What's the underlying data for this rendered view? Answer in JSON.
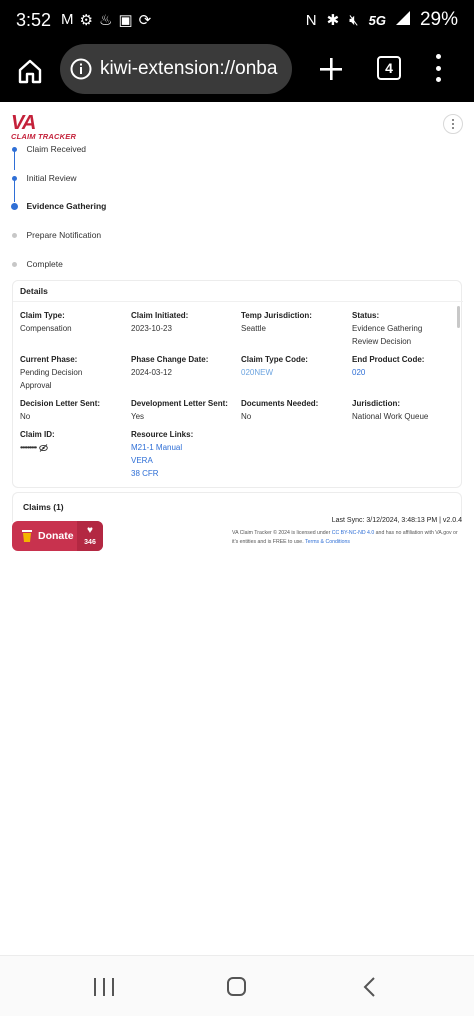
{
  "status_bar": {
    "time": "3:52",
    "left_icons": [
      "gmail-icon",
      "settings-icon",
      "fire-icon",
      "gallery-icon",
      "sync-icon"
    ],
    "network": "5G",
    "battery": "29%"
  },
  "browser": {
    "url": "kiwi-extension://onba",
    "tab_count": "4"
  },
  "app": {
    "logo_main": "VA",
    "logo_sub": "CLAIM TRACKER"
  },
  "timeline": {
    "steps": [
      {
        "label": "Claim Received",
        "state": "done"
      },
      {
        "label": "Initial Review",
        "state": "done"
      },
      {
        "label": "Evidence Gathering",
        "state": "current"
      },
      {
        "label": "Prepare Notification",
        "state": "pending"
      },
      {
        "label": "Complete",
        "state": "pending"
      }
    ]
  },
  "details": {
    "title": "Details",
    "claim_type_label": "Claim Type:",
    "claim_type_value": "Compensation",
    "claim_initiated_label": "Claim Initiated:",
    "claim_initiated_value": "2023-10-23",
    "temp_jurisdiction_label": "Temp Jurisdiction:",
    "temp_jurisdiction_value": "Seattle",
    "status_label": "Status:",
    "status_value": "Evidence Gathering Review Decision",
    "current_phase_label": "Current Phase:",
    "current_phase_value": "Pending Decision Approval",
    "phase_change_label": "Phase Change Date:",
    "phase_change_value": "2024-03-12",
    "claim_type_code_label": "Claim Type Code:",
    "claim_type_code_value": "020NEW",
    "end_product_code_label": "End Product Code:",
    "end_product_code_value": "020",
    "decision_letter_label": "Decision Letter Sent:",
    "decision_letter_value": "No",
    "development_letter_label": "Development Letter Sent:",
    "development_letter_value": "Yes",
    "documents_needed_label": "Documents Needed:",
    "documents_needed_value": "No",
    "jurisdiction_label": "Jurisdiction:",
    "jurisdiction_value": "National Work Queue",
    "claim_id_label": "Claim ID:",
    "claim_id_value": "•••••••••",
    "resource_links_label": "Resource Links:",
    "resource_links": [
      "M21-1 Manual",
      "VERA",
      "38 CFR"
    ]
  },
  "claims": {
    "title": "Claims (1)"
  },
  "donate": {
    "label": "Donate",
    "count": "346"
  },
  "footer": {
    "last_sync": "Last Sync: 3/12/2024, 3:48:13 PM | v2.0.4",
    "license_part1": "VA Claim Tracker © 2024 is licensed under ",
    "license_link": "CC BY-NC-ND 4.0",
    "license_part2": " and has no affiliation with VA.gov or it's entities and is FREE to use. ",
    "terms_link": "Terms & Conditions"
  },
  "colors": {
    "brand_red": "#c4213a",
    "donate_red": "#c8324e",
    "link_blue": "#2f6fd6"
  }
}
